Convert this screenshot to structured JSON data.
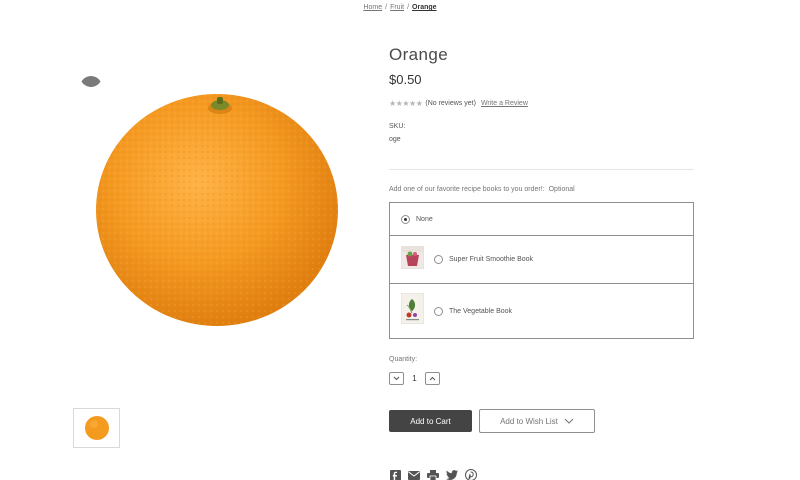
{
  "breadcrumbs": {
    "items": [
      "Home",
      "Fruit",
      "Orange"
    ],
    "separator": "/"
  },
  "product": {
    "title": "Orange",
    "price": "$0.50",
    "rating": {
      "stars": 0,
      "max": 5,
      "text": "(No reviews yet)"
    },
    "write_review": "Write a Review",
    "sku_label": "SKU:",
    "sku_value": "oge"
  },
  "options": {
    "label": "Add one of our favorite recipe books to you order!:",
    "optional_text": "Optional",
    "choices": [
      {
        "label": "None",
        "selected": true
      },
      {
        "label": "Super Fruit Smoothie Book",
        "selected": false
      },
      {
        "label": "The Vegetable Book",
        "selected": false
      }
    ]
  },
  "quantity": {
    "label": "Quantity:",
    "value": "1"
  },
  "actions": {
    "add_to_cart": "Add to Cart",
    "add_to_wishlist": "Add to Wish List"
  },
  "share": {
    "icons": [
      "facebook-icon",
      "email-icon",
      "print-icon",
      "twitter-icon",
      "pinterest-icon"
    ]
  },
  "colors": {
    "primary_button": "#444444",
    "orange": "#f39a1f",
    "border": "#8f8f8f"
  }
}
